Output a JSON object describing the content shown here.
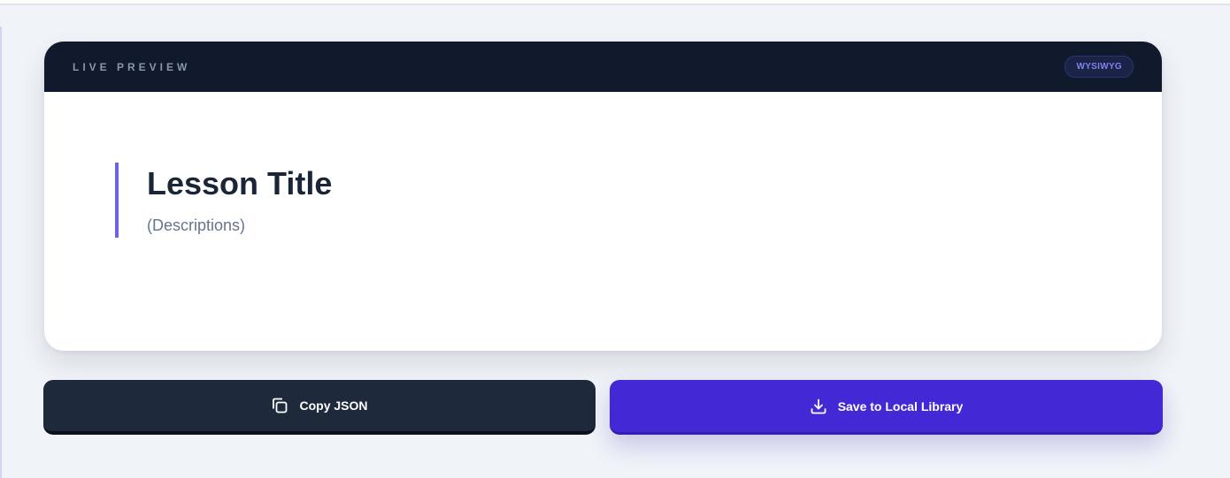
{
  "preview": {
    "label": "LIVE PREVIEW",
    "badge": "WYSIWYG"
  },
  "lesson": {
    "title": "Lesson Title",
    "description": "(Descriptions)"
  },
  "actions": {
    "copy_label": "Copy JSON",
    "copy_icon": "copy-icon",
    "save_label": "Save to Local Library",
    "save_icon": "download-icon"
  },
  "colors": {
    "header_bg": "#111a2d",
    "accent": "#6b63e6",
    "primary_button": "#4329d6",
    "secondary_button": "#1e293b",
    "page_bg": "#f0f3f8"
  }
}
